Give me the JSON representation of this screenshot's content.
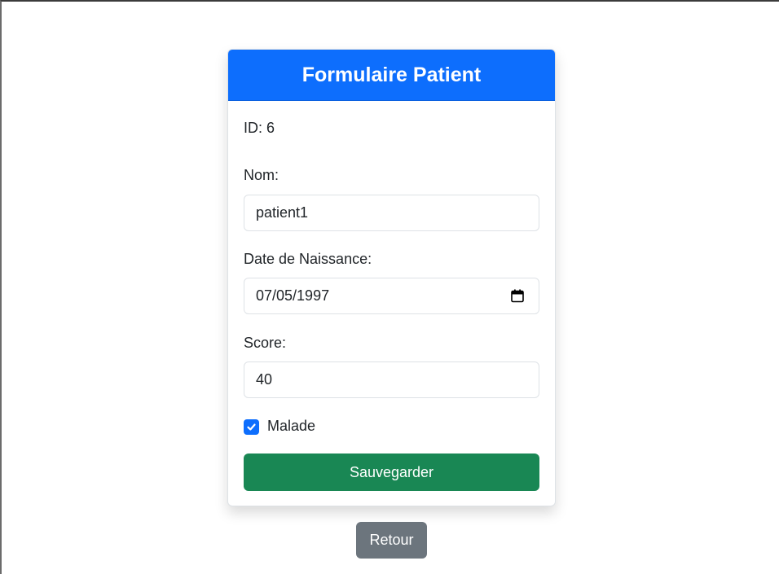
{
  "form": {
    "title": "Formulaire Patient",
    "id_text": "ID: 6",
    "nom_label": "Nom:",
    "nom_value": "patient1",
    "date_label": "Date de Naissance:",
    "date_value": "07/05/1997",
    "score_label": "Score:",
    "score_value": "40",
    "malade_label": "Malade",
    "malade_checked": true,
    "save_label": "Sauvegarder"
  },
  "back_label": "Retour",
  "colors": {
    "header": "#0d6efd",
    "save_button": "#198754",
    "back_button": "#6c757d",
    "checkbox": "#0d6efd"
  },
  "icons": {
    "date_picker": "calendar-icon",
    "checkbox_mark": "check-icon"
  }
}
